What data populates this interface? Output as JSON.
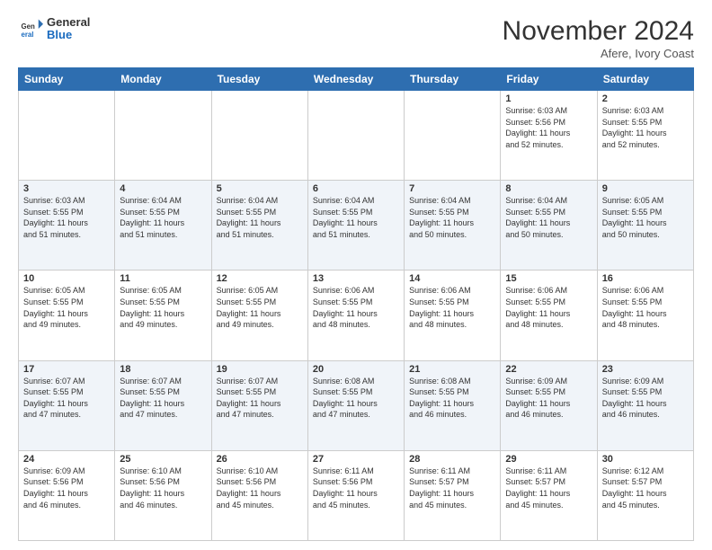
{
  "header": {
    "logo_general": "General",
    "logo_blue": "Blue",
    "month_title": "November 2024",
    "location": "Afere, Ivory Coast"
  },
  "weekdays": [
    "Sunday",
    "Monday",
    "Tuesday",
    "Wednesday",
    "Thursday",
    "Friday",
    "Saturday"
  ],
  "weeks": [
    [
      {
        "day": "",
        "info": ""
      },
      {
        "day": "",
        "info": ""
      },
      {
        "day": "",
        "info": ""
      },
      {
        "day": "",
        "info": ""
      },
      {
        "day": "",
        "info": ""
      },
      {
        "day": "1",
        "info": "Sunrise: 6:03 AM\nSunset: 5:56 PM\nDaylight: 11 hours\nand 52 minutes."
      },
      {
        "day": "2",
        "info": "Sunrise: 6:03 AM\nSunset: 5:55 PM\nDaylight: 11 hours\nand 52 minutes."
      }
    ],
    [
      {
        "day": "3",
        "info": "Sunrise: 6:03 AM\nSunset: 5:55 PM\nDaylight: 11 hours\nand 51 minutes."
      },
      {
        "day": "4",
        "info": "Sunrise: 6:04 AM\nSunset: 5:55 PM\nDaylight: 11 hours\nand 51 minutes."
      },
      {
        "day": "5",
        "info": "Sunrise: 6:04 AM\nSunset: 5:55 PM\nDaylight: 11 hours\nand 51 minutes."
      },
      {
        "day": "6",
        "info": "Sunrise: 6:04 AM\nSunset: 5:55 PM\nDaylight: 11 hours\nand 51 minutes."
      },
      {
        "day": "7",
        "info": "Sunrise: 6:04 AM\nSunset: 5:55 PM\nDaylight: 11 hours\nand 50 minutes."
      },
      {
        "day": "8",
        "info": "Sunrise: 6:04 AM\nSunset: 5:55 PM\nDaylight: 11 hours\nand 50 minutes."
      },
      {
        "day": "9",
        "info": "Sunrise: 6:05 AM\nSunset: 5:55 PM\nDaylight: 11 hours\nand 50 minutes."
      }
    ],
    [
      {
        "day": "10",
        "info": "Sunrise: 6:05 AM\nSunset: 5:55 PM\nDaylight: 11 hours\nand 49 minutes."
      },
      {
        "day": "11",
        "info": "Sunrise: 6:05 AM\nSunset: 5:55 PM\nDaylight: 11 hours\nand 49 minutes."
      },
      {
        "day": "12",
        "info": "Sunrise: 6:05 AM\nSunset: 5:55 PM\nDaylight: 11 hours\nand 49 minutes."
      },
      {
        "day": "13",
        "info": "Sunrise: 6:06 AM\nSunset: 5:55 PM\nDaylight: 11 hours\nand 48 minutes."
      },
      {
        "day": "14",
        "info": "Sunrise: 6:06 AM\nSunset: 5:55 PM\nDaylight: 11 hours\nand 48 minutes."
      },
      {
        "day": "15",
        "info": "Sunrise: 6:06 AM\nSunset: 5:55 PM\nDaylight: 11 hours\nand 48 minutes."
      },
      {
        "day": "16",
        "info": "Sunrise: 6:06 AM\nSunset: 5:55 PM\nDaylight: 11 hours\nand 48 minutes."
      }
    ],
    [
      {
        "day": "17",
        "info": "Sunrise: 6:07 AM\nSunset: 5:55 PM\nDaylight: 11 hours\nand 47 minutes."
      },
      {
        "day": "18",
        "info": "Sunrise: 6:07 AM\nSunset: 5:55 PM\nDaylight: 11 hours\nand 47 minutes."
      },
      {
        "day": "19",
        "info": "Sunrise: 6:07 AM\nSunset: 5:55 PM\nDaylight: 11 hours\nand 47 minutes."
      },
      {
        "day": "20",
        "info": "Sunrise: 6:08 AM\nSunset: 5:55 PM\nDaylight: 11 hours\nand 47 minutes."
      },
      {
        "day": "21",
        "info": "Sunrise: 6:08 AM\nSunset: 5:55 PM\nDaylight: 11 hours\nand 46 minutes."
      },
      {
        "day": "22",
        "info": "Sunrise: 6:09 AM\nSunset: 5:55 PM\nDaylight: 11 hours\nand 46 minutes."
      },
      {
        "day": "23",
        "info": "Sunrise: 6:09 AM\nSunset: 5:55 PM\nDaylight: 11 hours\nand 46 minutes."
      }
    ],
    [
      {
        "day": "24",
        "info": "Sunrise: 6:09 AM\nSunset: 5:56 PM\nDaylight: 11 hours\nand 46 minutes."
      },
      {
        "day": "25",
        "info": "Sunrise: 6:10 AM\nSunset: 5:56 PM\nDaylight: 11 hours\nand 46 minutes."
      },
      {
        "day": "26",
        "info": "Sunrise: 6:10 AM\nSunset: 5:56 PM\nDaylight: 11 hours\nand 45 minutes."
      },
      {
        "day": "27",
        "info": "Sunrise: 6:11 AM\nSunset: 5:56 PM\nDaylight: 11 hours\nand 45 minutes."
      },
      {
        "day": "28",
        "info": "Sunrise: 6:11 AM\nSunset: 5:57 PM\nDaylight: 11 hours\nand 45 minutes."
      },
      {
        "day": "29",
        "info": "Sunrise: 6:11 AM\nSunset: 5:57 PM\nDaylight: 11 hours\nand 45 minutes."
      },
      {
        "day": "30",
        "info": "Sunrise: 6:12 AM\nSunset: 5:57 PM\nDaylight: 11 hours\nand 45 minutes."
      }
    ]
  ]
}
